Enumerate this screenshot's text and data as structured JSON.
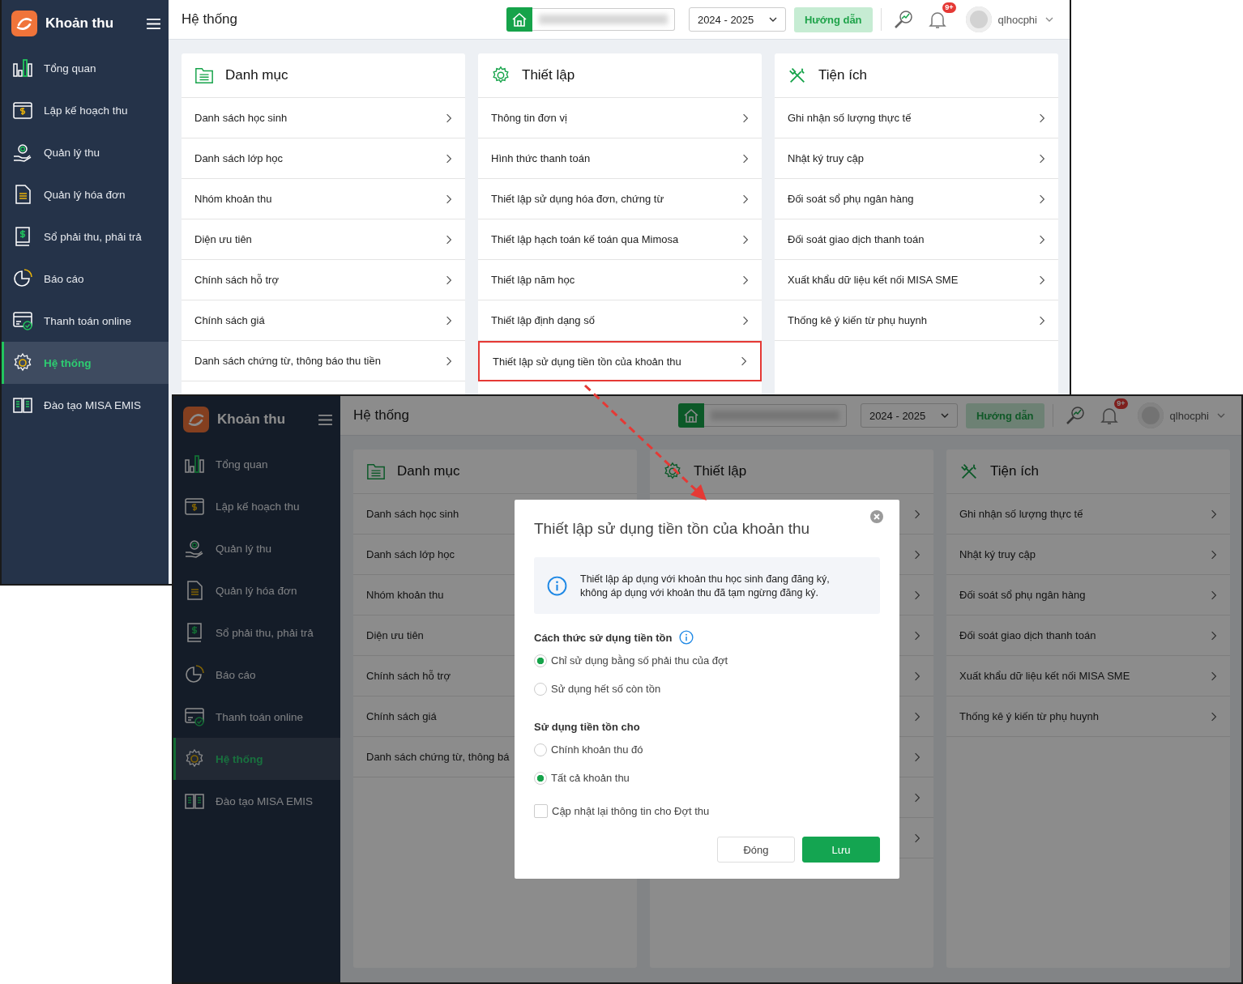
{
  "screens": [
    {
      "brand": "Khoản thu",
      "page_title": "Hệ thống",
      "year": "2024 - 2025",
      "guide_button": "Hướng dẫn",
      "notification_badge": "9+",
      "user": "qlhocphi",
      "dimmed": false,
      "sidebar": [
        {
          "label": "Tổng quan",
          "selected": false
        },
        {
          "label": "Lập kế hoạch thu",
          "selected": false
        },
        {
          "label": "Quản lý thu",
          "selected": false
        },
        {
          "label": "Quản lý hóa đơn",
          "selected": false
        },
        {
          "label": "Sổ phải thu, phải trả",
          "selected": false
        },
        {
          "label": "Báo cáo",
          "selected": false
        },
        {
          "label": "Thanh toán online",
          "selected": false
        },
        {
          "label": "Hệ thống",
          "selected": true
        },
        {
          "label": "Đào tạo MISA EMIS",
          "selected": false
        }
      ],
      "cards": [
        {
          "title": "Danh mục",
          "items": [
            {
              "kind": "row",
              "label": "Danh sách học sinh",
              "highlighted": false
            },
            {
              "kind": "row",
              "label": "Danh sách lớp học",
              "highlighted": false
            },
            {
              "kind": "row",
              "label": "Nhóm khoản thu",
              "highlighted": false
            },
            {
              "kind": "row",
              "label": "Diện ưu tiên",
              "highlighted": false
            },
            {
              "kind": "row",
              "label": "Chính sách hỗ trợ",
              "highlighted": false
            },
            {
              "kind": "row",
              "label": "Chính sách giá",
              "highlighted": false
            },
            {
              "kind": "row",
              "label": "Danh sách chứng từ, thông báo thu tiền",
              "highlighted": false
            }
          ]
        },
        {
          "title": "Thiết lập",
          "items": [
            {
              "kind": "row",
              "label": "Thông tin đơn vị",
              "highlighted": false
            },
            {
              "kind": "row",
              "label": "Hình thức thanh toán",
              "highlighted": false
            },
            {
              "kind": "row",
              "label": "Thiết lập sử dụng hóa đơn, chứng từ",
              "highlighted": false
            },
            {
              "kind": "row",
              "label": "Thiết lập hạch toán kế toán qua Mimosa",
              "highlighted": false
            },
            {
              "kind": "row",
              "label": "Thiết lập năm học",
              "highlighted": false
            },
            {
              "kind": "row",
              "label": "Thiết lập định dạng số",
              "highlighted": false
            },
            {
              "kind": "row",
              "label": "Thiết lập sử dụng tiền tồn của khoản thu",
              "highlighted": true
            }
          ]
        },
        {
          "title": "Tiện ích",
          "items": [
            {
              "kind": "row",
              "label": "Ghi nhận số lượng thực tế",
              "highlighted": false
            },
            {
              "kind": "row",
              "label": "Nhật ký truy cập",
              "highlighted": false
            },
            {
              "kind": "row",
              "label": "Đối soát sổ phụ ngân hàng",
              "highlighted": false
            },
            {
              "kind": "row",
              "label": "Đối soát giao dịch thanh toán",
              "highlighted": false
            },
            {
              "kind": "row",
              "label": "Xuất khẩu dữ liệu kết nối MISA SME",
              "highlighted": false
            },
            {
              "kind": "row",
              "label": "Thống kê ý kiến từ phụ huynh",
              "highlighted": false
            }
          ]
        }
      ]
    },
    {
      "brand": "Khoản thu",
      "page_title": "Hệ thống",
      "year": "2024 - 2025",
      "guide_button": "Hướng dẫn",
      "notification_badge": "9+",
      "user": "qlhocphi",
      "dimmed": true,
      "sidebar": [
        {
          "label": "Tổng quan",
          "selected": false
        },
        {
          "label": "Lập kế hoạch thu",
          "selected": false
        },
        {
          "label": "Quản lý thu",
          "selected": false
        },
        {
          "label": "Quản lý hóa đơn",
          "selected": false
        },
        {
          "label": "Sổ phải thu, phải trả",
          "selected": false
        },
        {
          "label": "Báo cáo",
          "selected": false
        },
        {
          "label": "Thanh toán online",
          "selected": false
        },
        {
          "label": "Hệ thống",
          "selected": true
        },
        {
          "label": "Đào tạo MISA EMIS",
          "selected": false
        }
      ],
      "cards": [
        {
          "title": "Danh mục",
          "items": [
            {
              "kind": "text_only",
              "label": "Danh sách học sinh",
              "highlighted": false
            },
            {
              "kind": "text_only",
              "label": "Danh sách lớp học",
              "highlighted": false
            },
            {
              "kind": "text_only",
              "label": "Nhóm khoản thu",
              "highlighted": false
            },
            {
              "kind": "text_only",
              "label": "Diện ưu tiên",
              "highlighted": false
            },
            {
              "kind": "text_only",
              "label": "Chính sách hỗ trợ",
              "highlighted": false
            },
            {
              "kind": "text_only",
              "label": "Chính sách giá",
              "highlighted": false
            },
            {
              "kind": "text_only",
              "label": "Danh sách chứng từ, thông bá",
              "highlighted": false
            }
          ]
        },
        {
          "title": "Thiết lập",
          "items": [
            {
              "kind": "covered",
              "highlighted": false
            },
            {
              "kind": "covered",
              "highlighted": false
            },
            {
              "kind": "covered",
              "highlighted": false
            },
            {
              "kind": "covered",
              "highlighted": false
            },
            {
              "kind": "covered",
              "highlighted": false
            },
            {
              "kind": "covered",
              "highlighted": false
            },
            {
              "kind": "covered",
              "highlighted": false
            },
            {
              "kind": "covered",
              "highlighted": false
            },
            {
              "kind": "covered",
              "highlighted": false
            }
          ]
        },
        {
          "title": "Tiện ích",
          "items": [
            {
              "kind": "row",
              "label": "Ghi nhận số lượng thực tế",
              "highlighted": false
            },
            {
              "kind": "row",
              "label": "Nhật ký truy cập",
              "highlighted": false
            },
            {
              "kind": "row",
              "label": "Đối soát sổ phụ ngân hàng",
              "highlighted": false
            },
            {
              "kind": "row",
              "label": "Đối soát giao dịch thanh toán",
              "highlighted": false
            },
            {
              "kind": "row",
              "label": "Xuất khẩu dữ liệu kết nối MISA SME",
              "highlighted": false
            },
            {
              "kind": "row",
              "label": "Thống kê ý kiến từ phụ huynh",
              "highlighted": false
            }
          ]
        }
      ]
    }
  ],
  "dialog": {
    "title": "Thiết lập sử dụng tiền tồn của khoản thu",
    "info_lines": [
      "Thiết lập áp dụng với khoản thu học sinh đang đăng ký,",
      "không áp dụng với khoản thu đã tạm ngừng đăng ký."
    ],
    "sections": [
      {
        "heading": "Cách thức sử dụng tiền tồn",
        "has_info": true,
        "options": [
          {
            "label": "Chỉ sử dụng bằng số phải thu của đợt",
            "selected": true
          },
          {
            "label": "Sử dụng hết số còn tồn",
            "selected": false
          }
        ]
      },
      {
        "heading": "Sử dụng tiền tồn cho",
        "has_info": false,
        "options": [
          {
            "label": "Chính khoản thu đó",
            "selected": false
          },
          {
            "label": "Tất cả khoản thu",
            "selected": true
          }
        ]
      }
    ],
    "checkbox": {
      "label": "Cập nhật lại thông tin cho Đợt thu",
      "checked": false
    },
    "buttons": [
      {
        "label": "Đóng",
        "kind": "secondary"
      },
      {
        "label": "Lưu",
        "kind": "primary"
      }
    ]
  }
}
